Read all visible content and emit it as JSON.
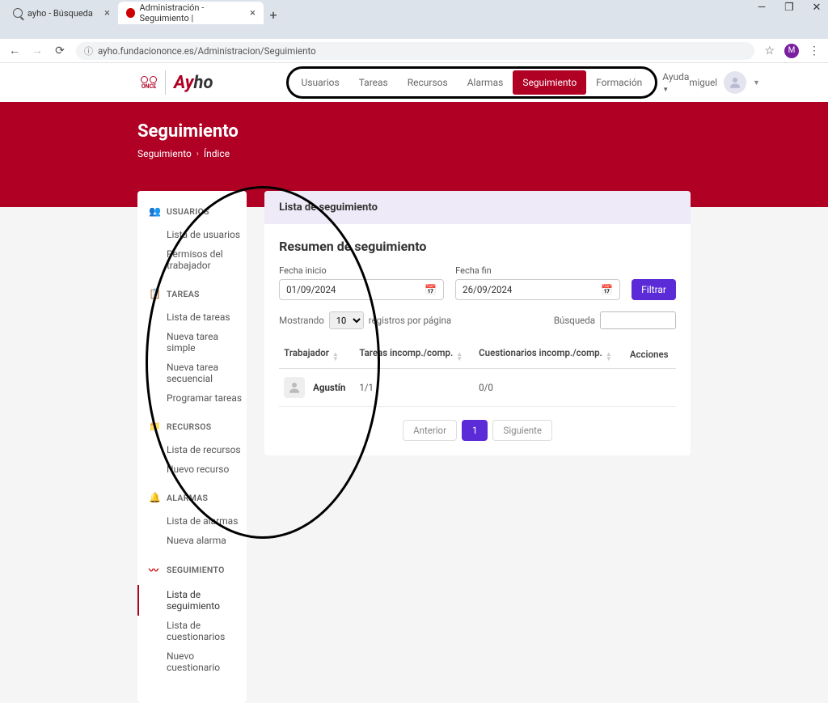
{
  "browser": {
    "tabs": [
      {
        "title": "ayho - Búsqueda",
        "active": false
      },
      {
        "title": "Administración - Seguimiento |",
        "active": true
      }
    ],
    "url": "ayho.fundaciononce.es/Administracion/Seguimiento",
    "avatar_initial": "M"
  },
  "brand": {
    "once": "ONCE",
    "ayho_a": "Ay",
    "ayho_b": "ho"
  },
  "top_nav": {
    "items": [
      "Usuarios",
      "Tareas",
      "Recursos",
      "Alarmas",
      "Seguimiento",
      "Formación"
    ],
    "active_index": 4,
    "help": "Ayuda"
  },
  "user": {
    "name": "miguel"
  },
  "page": {
    "title": "Seguimiento",
    "breadcrumb": [
      "Seguimiento",
      "Índice"
    ]
  },
  "sidebar": [
    {
      "label": "USUARIOS",
      "icon": "users",
      "items": [
        "Lista de usuarios",
        "Permisos del trabajador"
      ]
    },
    {
      "label": "TAREAS",
      "icon": "tasks",
      "items": [
        "Lista de tareas",
        "Nueva tarea simple",
        "Nueva tarea secuencial",
        "Programar tareas"
      ]
    },
    {
      "label": "RECURSOS",
      "icon": "folder",
      "items": [
        "Lista de recursos",
        "Nuevo recurso"
      ]
    },
    {
      "label": "ALARMAS",
      "icon": "bell",
      "items": [
        "Lista de alarmas",
        "Nueva alarma"
      ]
    },
    {
      "label": "SEGUIMIENTO",
      "icon": "pulse",
      "items": [
        "Lista de seguimiento",
        "Lista de cuestionarios",
        "Nuevo cuestionario"
      ],
      "active_item": 0
    }
  ],
  "card": {
    "heading": "Lista de seguimiento",
    "title": "Resumen de seguimiento",
    "date_start_label": "Fecha inicio",
    "date_start_value": "01/09/2024",
    "date_end_label": "Fecha fin",
    "date_end_value": "26/09/2024",
    "filter_btn": "Filtrar",
    "showing_pre": "Mostrando",
    "per_page": "10",
    "showing_post": "registros por página",
    "search_label": "Búsqueda",
    "columns": [
      "Trabajador",
      "Tareas incomp./comp.",
      "Cuestionarios incomp./comp.",
      "Acciones"
    ],
    "rows": [
      {
        "name": "Agustín",
        "tasks": "1/1",
        "quest": "0/0"
      }
    ],
    "pager_prev": "Anterior",
    "pager_page": "1",
    "pager_next": "Siguiente"
  }
}
